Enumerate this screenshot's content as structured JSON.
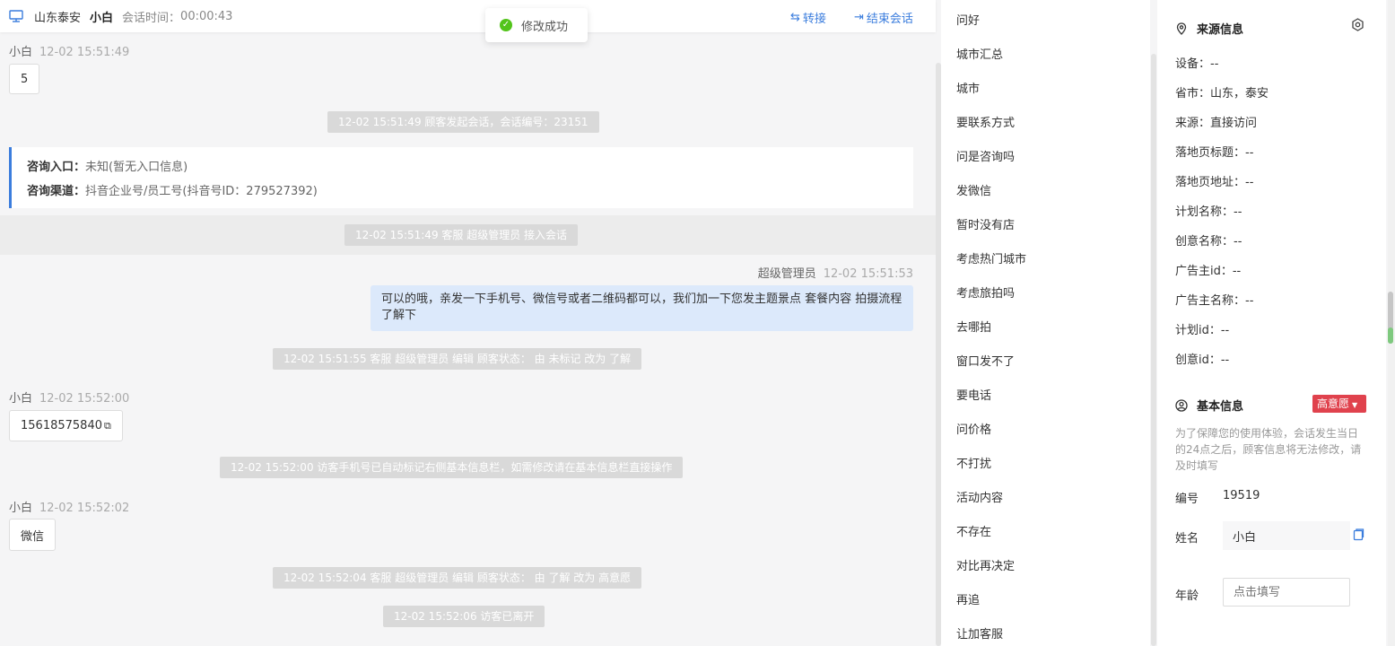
{
  "header": {
    "location": "山东泰安",
    "customer_name": "小白",
    "session_time_label": "会话时间：",
    "session_time_value": "00:00:43",
    "transfer_label": "转接",
    "end_label": "结束会话"
  },
  "toast": {
    "text": "修改成功"
  },
  "messages": {
    "m1_name": "小白",
    "m1_time": "12-02 15:51:49",
    "m1_text": "5",
    "sys1": "12-02 15:51:49 顾客发起会话，会话编号：23151",
    "entry_label1": "咨询入口：",
    "entry_value1": "未知(暂无入口信息)",
    "entry_label2": "咨询渠道：",
    "entry_value2": "抖音企业号/员工号(抖音号ID：279527392)",
    "sys2": "12-02 15:51:49 客服 超级管理员 接入会话",
    "agent_name": "超级管理员",
    "agent_time": "12-02 15:51:53",
    "agent_text": "可以的哦，亲发一下手机号、微信号或者二维码都可以，我们加一下您发主题景点 套餐内容 拍摄流程了解下",
    "sys3": "12-02 15:51:55 客服 超级管理员 编辑 顾客状态： 由 未标记 改为 了解",
    "m2_name": "小白",
    "m2_time": "12-02 15:52:00",
    "m2_text": "15618575840",
    "sys4": "12-02 15:52:00 访客手机号已自动标记右侧基本信息栏，如需修改请在基本信息栏直接操作",
    "m3_name": "小白",
    "m3_time": "12-02 15:52:02",
    "m3_text": "微信",
    "sys5": "12-02 15:52:04 客服 超级管理员 编辑 顾客状态： 由 了解 改为 高意愿",
    "sys6": "12-02 15:52:06 访客已离开"
  },
  "quick_replies": [
    "问好",
    "城市汇总",
    "城市",
    "要联系方式",
    "问是咨询吗",
    "发微信",
    "暂时没有店",
    "考虑热门城市",
    "考虑旅拍吗",
    "去哪拍",
    "窗口发不了",
    "要电话",
    "问价格",
    "不打扰",
    "活动内容",
    "不存在",
    "对比再决定",
    "再追",
    "让加客服"
  ],
  "source_info": {
    "title": "来源信息",
    "rows": [
      "设备：--",
      "省市：山东，泰安",
      "来源：直接访问",
      "落地页标题：--",
      "落地页地址：--",
      "计划名称：--",
      "创意名称：--",
      "广告主id：--",
      "广告主名称：--",
      "计划id：--",
      "创意id：--"
    ]
  },
  "basic_info": {
    "title": "基本信息",
    "tag": "高意愿",
    "hint": "为了保障您的使用体验，会话发生当日的24点之后，顾客信息将无法修改，请及时填写",
    "id_label": "编号",
    "id_value": "19519",
    "name_label": "姓名",
    "name_value": "小白",
    "age_label": "年龄",
    "age_placeholder": "点击填写"
  },
  "colors": {
    "accent": "#3b7ddd",
    "tag": "#e0424d",
    "success": "#52c41a",
    "agent_bubble": "#dce9fb"
  }
}
